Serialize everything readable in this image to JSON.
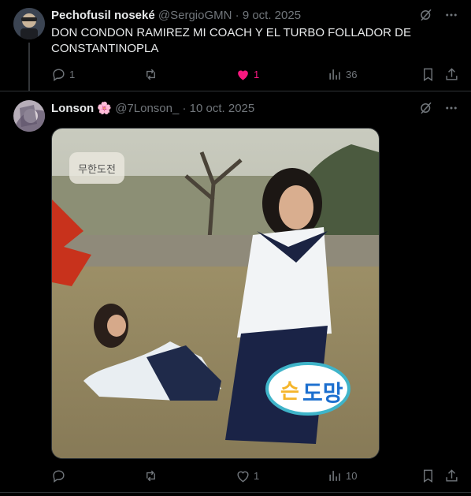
{
  "posts": [
    {
      "author_name": "Pechofusil noseké",
      "handle": "@SergioGMN",
      "separator": "·",
      "date": "9 oct. 2025",
      "text": "DON CONDON RAMIREZ MI COACH Y EL TURBO FOLLADOR DE CONSTANTINOPLA",
      "replies": "1",
      "reposts": "",
      "likes": "1",
      "liked": true,
      "views": "36"
    },
    {
      "author_name": "Lonson",
      "name_emoji": "🌸",
      "handle": "@7Lonson_",
      "separator": "·",
      "date": "10 oct. 2025",
      "text": "",
      "replies": "",
      "reposts": "",
      "likes": "1",
      "liked": false,
      "views": "10",
      "media_caption": "도망",
      "media_caption_prefix": "슨",
      "media_logo": "무한도전"
    }
  ],
  "colors": {
    "like_active": "#f91880",
    "muted": "#71767b",
    "text": "#e7e9ea",
    "background": "#000000"
  }
}
